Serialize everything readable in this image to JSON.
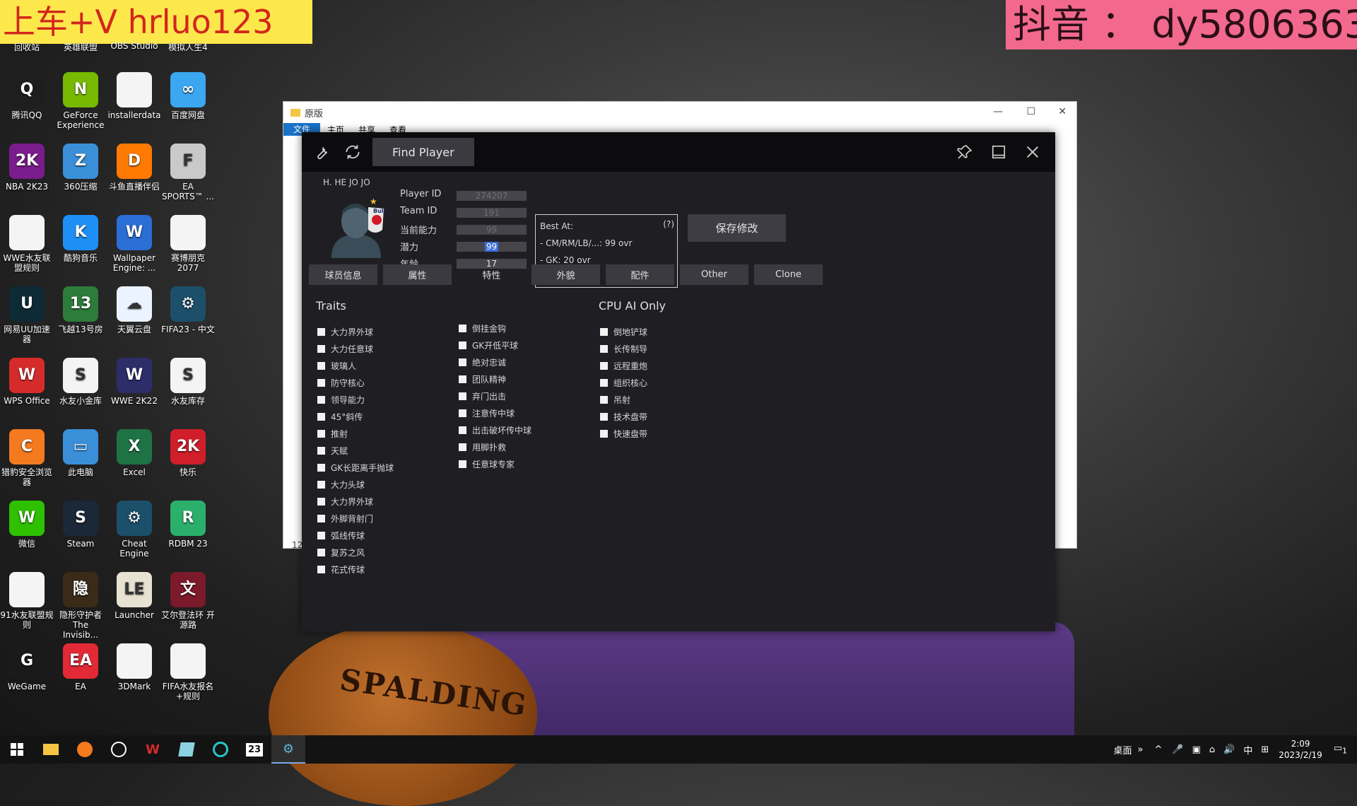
{
  "overlays": {
    "left_text": "上车+V  hrluo123",
    "right_text": "抖音 ： dy5806363"
  },
  "desktop": {
    "top_row": [
      "回收站",
      "英雄联盟",
      "OBS Studio",
      "模拟人生4"
    ],
    "icons": [
      {
        "label": "腾讯QQ",
        "icon": "qq-icon",
        "glyph": "Q",
        "color": "#1e1e1e"
      },
      {
        "label": "GeForce Experience",
        "icon": "nvidia-icon",
        "glyph": "N",
        "color": "#76b900"
      },
      {
        "label": "installerdata",
        "icon": "file-icon",
        "glyph": "",
        "color": "#f4f4f4"
      },
      {
        "label": "百度网盘",
        "icon": "baidu-netdisk-icon",
        "glyph": "∞",
        "color": "#3aa7f0"
      },
      {
        "label": "NBA 2K23",
        "icon": "nba2k23-icon",
        "glyph": "2K",
        "color": "#7a1c8c"
      },
      {
        "label": "360压缩",
        "icon": "360zip-icon",
        "glyph": "Z",
        "color": "#3b8fd8"
      },
      {
        "label": "斗鱼直播伴侣",
        "icon": "douyu-icon",
        "glyph": "D",
        "color": "#ff7a00"
      },
      {
        "label": "EA SPORTS™ ...",
        "icon": "fifa23-icon",
        "glyph": "F",
        "color": "#c9c9c9"
      },
      {
        "label": "WWE水友联盟规则",
        "icon": "file-icon",
        "glyph": "",
        "color": "#f4f4f4"
      },
      {
        "label": "酷狗音乐",
        "icon": "kugou-icon",
        "glyph": "K",
        "color": "#1e8ff5"
      },
      {
        "label": "Wallpaper Engine: ...",
        "icon": "wallpaper-engine-icon",
        "glyph": "W",
        "color": "#2a6ed6"
      },
      {
        "label": "赛博朋克 2077",
        "icon": "file-icon",
        "glyph": "",
        "color": "#f4f4f4"
      },
      {
        "label": "网易UU加速器",
        "icon": "uu-icon",
        "glyph": "U",
        "color": "#0d2a35"
      },
      {
        "label": "飞越13号房",
        "icon": "game-icon",
        "glyph": "13",
        "color": "#2d7c3a"
      },
      {
        "label": "天翼云盘",
        "icon": "cloud-icon",
        "glyph": "☁",
        "color": "#eaf3ff"
      },
      {
        "label": "FIFA23 - 中文",
        "icon": "cheat-engine-icon",
        "glyph": "⚙",
        "color": "#1b4f6a"
      },
      {
        "label": "WPS Office",
        "icon": "wps-icon",
        "glyph": "W",
        "color": "#d62b2b"
      },
      {
        "label": "水友小金库",
        "icon": "sheet-icon",
        "glyph": "S",
        "color": "#f4f4f4"
      },
      {
        "label": "WWE 2K22",
        "icon": "wwe2k22-icon",
        "glyph": "W",
        "color": "#2d2d6a"
      },
      {
        "label": "水友库存",
        "icon": "sheet-icon",
        "glyph": "S",
        "color": "#f4f4f4"
      },
      {
        "label": "猎豹安全浏览器",
        "icon": "cheetah-browser-icon",
        "glyph": "C",
        "color": "#f37a1f"
      },
      {
        "label": "此电脑",
        "icon": "computer-icon",
        "glyph": "▭",
        "color": "#3a8fd8"
      },
      {
        "label": "Excel",
        "icon": "excel-icon",
        "glyph": "X",
        "color": "#1f7244"
      },
      {
        "label": "快乐",
        "icon": "2k-icon",
        "glyph": "2K",
        "color": "#d11e2b"
      },
      {
        "label": "微信",
        "icon": "wechat-icon",
        "glyph": "W",
        "color": "#2dc100"
      },
      {
        "label": "Steam",
        "icon": "steam-icon",
        "glyph": "S",
        "color": "#1b2838"
      },
      {
        "label": "Cheat Engine",
        "icon": "cheat-engine-icon",
        "glyph": "⚙",
        "color": "#1b4f6a"
      },
      {
        "label": "RDBM 23",
        "icon": "rdbm-icon",
        "glyph": "R",
        "color": "#2ab06a"
      },
      {
        "label": "91水友联盟规则",
        "icon": "file-icon",
        "glyph": "",
        "color": "#f4f4f4"
      },
      {
        "label": "隐形守护者 The Invisib...",
        "icon": "invisible-guardian-icon",
        "glyph": "隐",
        "color": "#3a2a18"
      },
      {
        "label": "Launcher",
        "icon": "launcher-icon",
        "glyph": "LE",
        "color": "#e8e2d2"
      },
      {
        "label": "艾尔登法环 开源路",
        "icon": "game-icon",
        "glyph": "文",
        "color": "#7a1a2a"
      },
      {
        "label": "WeGame",
        "icon": "wegame-icon",
        "glyph": "G",
        "color": "#1a1a1a"
      },
      {
        "label": "EA",
        "icon": "ea-icon",
        "glyph": "EA",
        "color": "#e22a36"
      },
      {
        "label": "3DMark",
        "icon": "file-icon",
        "glyph": "",
        "color": "#f4f4f4"
      },
      {
        "label": "FIFA水友报名+规则",
        "icon": "file-icon",
        "glyph": "",
        "color": "#f4f4f4"
      }
    ]
  },
  "explorer": {
    "title": "原版",
    "ribbon_tabs": [
      "文件",
      "主页",
      "共享",
      "查看"
    ],
    "status_left": "12"
  },
  "app": {
    "find_player": "Find Player",
    "player": {
      "name": "H. HE JO JO",
      "fields": [
        {
          "label": "Player ID",
          "value": "274207"
        },
        {
          "label": "Team ID",
          "value": "191"
        },
        {
          "label": "当前能力",
          "value": "99"
        },
        {
          "label": "潜力",
          "value": "99"
        },
        {
          "label": "年龄",
          "value": "17"
        }
      ]
    },
    "best_at": {
      "title": "Best At:",
      "help": "(?)",
      "lines": [
        "- CM/RM/LB/...: 99 ovr",
        "- GK: 20 ovr",
        "-"
      ]
    },
    "save_button": "保存修改",
    "tabs": [
      "球员信息",
      "属性",
      "特性",
      "外貌",
      "配件",
      "Other",
      "Clone"
    ],
    "selected_tab": "特性",
    "traits_heading": "Traits",
    "traits_col1": [
      "大力界外球",
      "大力任意球",
      "玻璃人",
      "防守核心",
      "领导能力",
      "45°斜传",
      "推射",
      "天赋",
      "GK长距离手抛球",
      "大力头球",
      "大力界外球",
      "外脚背射门",
      "弧线传球",
      "复苏之风",
      "花式传球"
    ],
    "traits_col2": [
      "倒挂金钩",
      "GK开低平球",
      "绝对忠诚",
      "团队精神",
      "弃门出击",
      "注意传中球",
      "出击破坏传中球",
      "用脚扑救",
      "任意球专家"
    ],
    "cpu_heading": "CPU AI Only",
    "cpu_traits": [
      "倒地铲球",
      "长传制导",
      "远程重炮",
      "组织核心",
      "吊射",
      "技术盘带",
      "快速盘带"
    ]
  },
  "taskbar": {
    "tray_label": "桌面",
    "ime": "中",
    "time": "2:09",
    "date": "2023/2/19",
    "notify_count": "1"
  }
}
